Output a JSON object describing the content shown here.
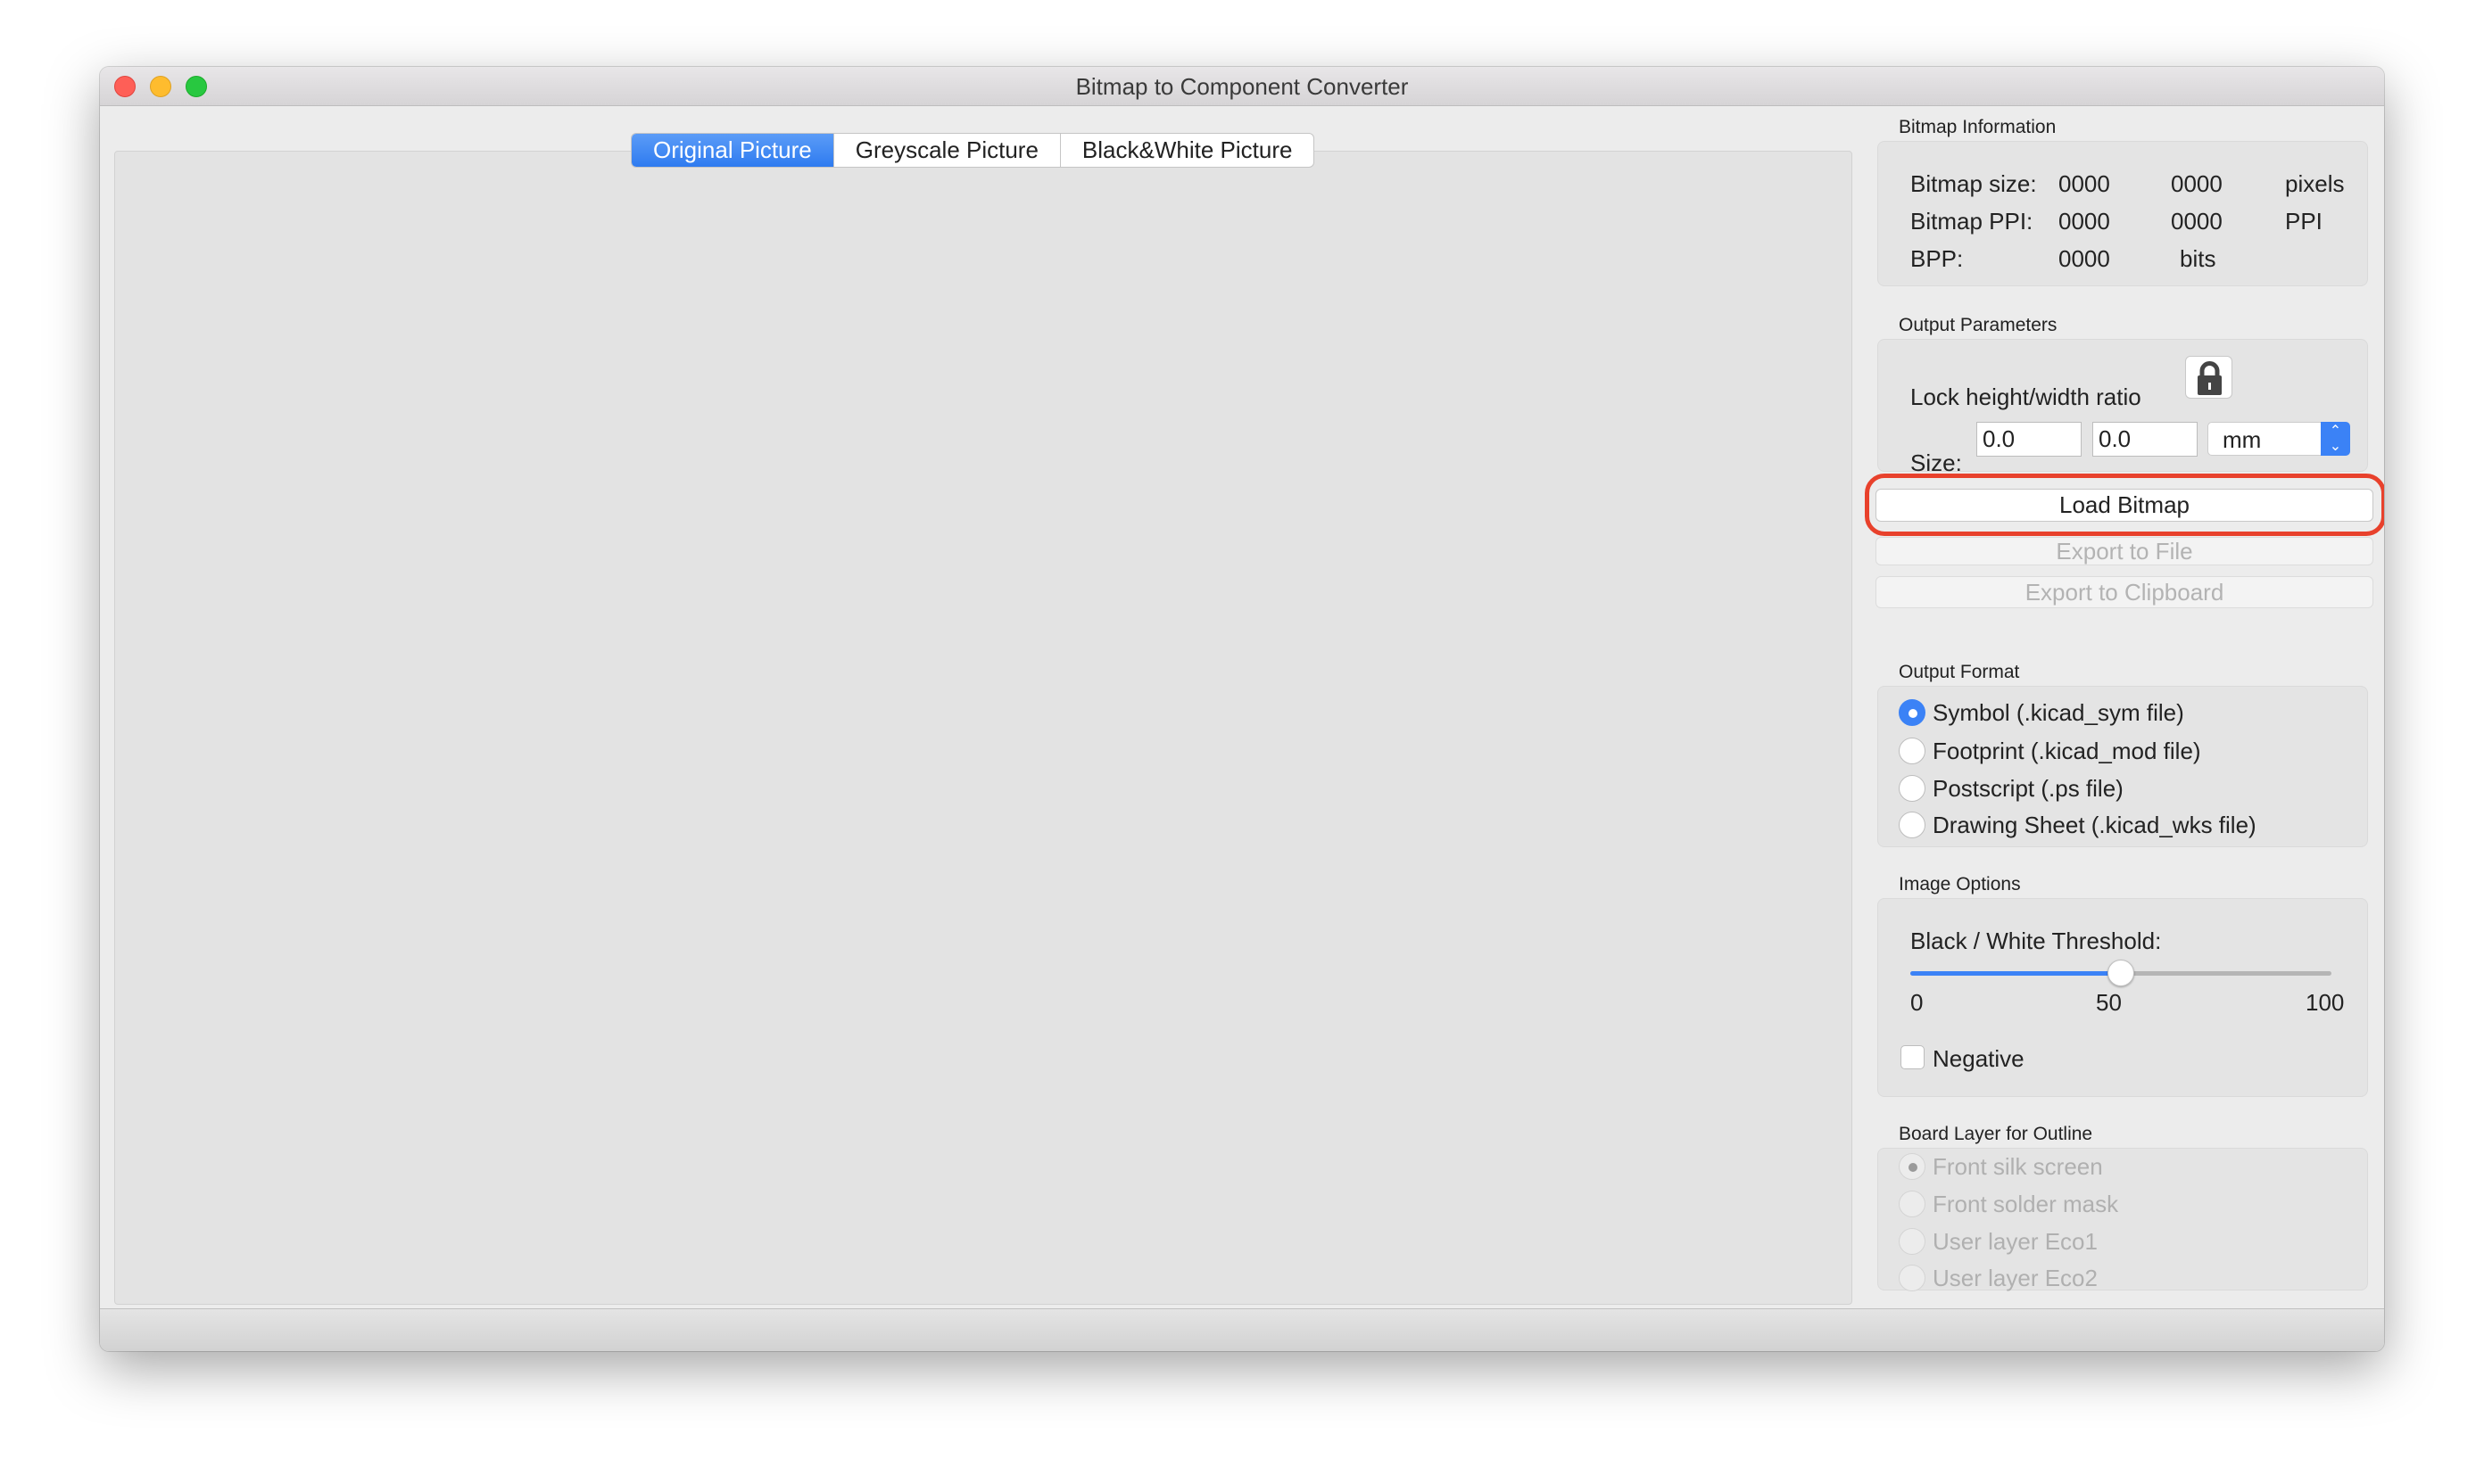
{
  "window": {
    "title": "Bitmap to Component Converter"
  },
  "tabs": [
    {
      "label": "Original Picture",
      "active": true
    },
    {
      "label": "Greyscale Picture",
      "active": false
    },
    {
      "label": "Black&White Picture",
      "active": false
    }
  ],
  "bitmap_info": {
    "label": "Bitmap Information",
    "rows": [
      {
        "label": "Bitmap size:",
        "v1": "0000",
        "v2": "0000",
        "unit": "pixels"
      },
      {
        "label": "Bitmap PPI:",
        "v1": "0000",
        "v2": "0000",
        "unit": "PPI"
      },
      {
        "label": "BPP:",
        "v1": "0000",
        "unit": "bits"
      }
    ]
  },
  "output_params": {
    "label": "Output Parameters",
    "lock_label": "Lock height/width ratio",
    "lock_icon": "lock-icon",
    "size_label": "Size:",
    "width": "0.0",
    "height": "0.0",
    "unit": "mm"
  },
  "buttons": {
    "load": "Load Bitmap",
    "export_file": "Export to File",
    "export_clipboard": "Export to Clipboard"
  },
  "highlight_color": "#e8412c",
  "output_format": {
    "label": "Output Format",
    "options": [
      "Symbol (.kicad_sym file)",
      "Footprint (.kicad_mod file)",
      "Postscript (.ps file)",
      "Drawing Sheet (.kicad_wks file)"
    ],
    "selected": 0
  },
  "image_options": {
    "label": "Image Options",
    "threshold_label": "Black / White Threshold:",
    "threshold_value": 50,
    "min": "0",
    "mid": "50",
    "max": "100",
    "negative_label": "Negative",
    "negative_checked": false
  },
  "board_layer": {
    "label": "Board Layer for Outline",
    "options": [
      "Front silk screen",
      "Front solder mask",
      "User layer Eco1",
      "User layer Eco2"
    ],
    "selected": 0,
    "disabled": true
  },
  "accent_color": "#3b82f6"
}
